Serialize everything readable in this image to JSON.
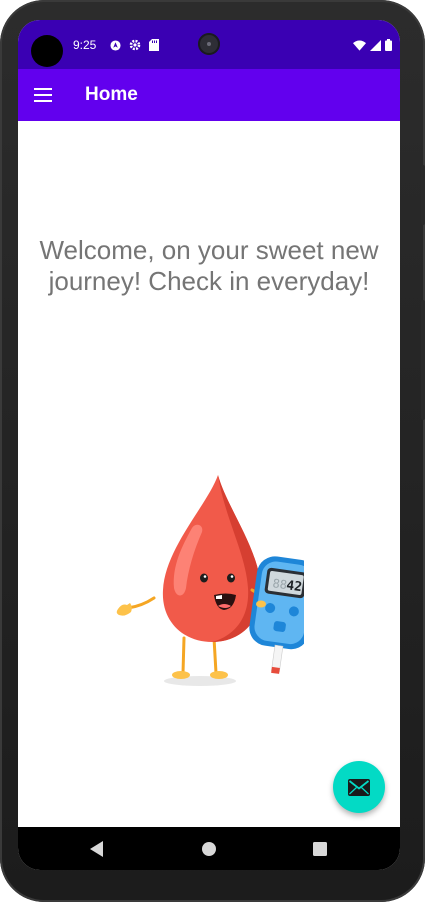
{
  "status_bar": {
    "time": "9:25",
    "left_icons": [
      "notification-icon",
      "settings-icon",
      "sd-card-icon"
    ],
    "right_icons": [
      "wifi-icon",
      "signal-icon",
      "battery-icon"
    ]
  },
  "app_bar": {
    "title": "Home",
    "menu_icon": "hamburger-menu-icon"
  },
  "main": {
    "welcome_message": "Welcome, on your sweet new journey! Check in everyday!",
    "illustration": {
      "description_icon": "blood-drop-glucose-meter-illustration",
      "meter_reading": "42",
      "meter_reading_faded": "88"
    }
  },
  "fab": {
    "icon": "mail-icon"
  },
  "nav_bar": {
    "buttons": [
      "back-icon",
      "home-icon",
      "recents-icon"
    ]
  },
  "colors": {
    "status_bar": "#3a00b3",
    "app_bar": "#6200ee",
    "fab": "#03dac5",
    "welcome_text": "#757575"
  }
}
